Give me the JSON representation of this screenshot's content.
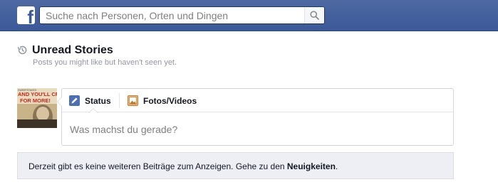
{
  "header": {
    "logo_letter": "f",
    "search": {
      "placeholder": "Suche nach Personen, Orten und Dingen",
      "value": ""
    }
  },
  "section": {
    "title": "Unread Stories",
    "subtitle": "Posts you might like but haven't seen yet."
  },
  "composer": {
    "tabs": [
      {
        "label": "Status",
        "icon": "pencil-icon",
        "active": true
      },
      {
        "label": "Fotos/Videos",
        "icon": "photo-icon",
        "active": false
      }
    ],
    "placeholder": "Was machst du gerade?",
    "avatar_text": [
      "AND YOU'LL CRY",
      "FOR MORE!"
    ]
  },
  "notice": {
    "text": "Derzeit gibt es keine weiteren Beiträge zum Anzeigen. Gehe zu den ",
    "link": "Neuigkeiten",
    "suffix": "."
  },
  "colors": {
    "brand_blue": "#3b5998",
    "notice_bg": "#edeff4",
    "muted_text": "#9197a3"
  }
}
